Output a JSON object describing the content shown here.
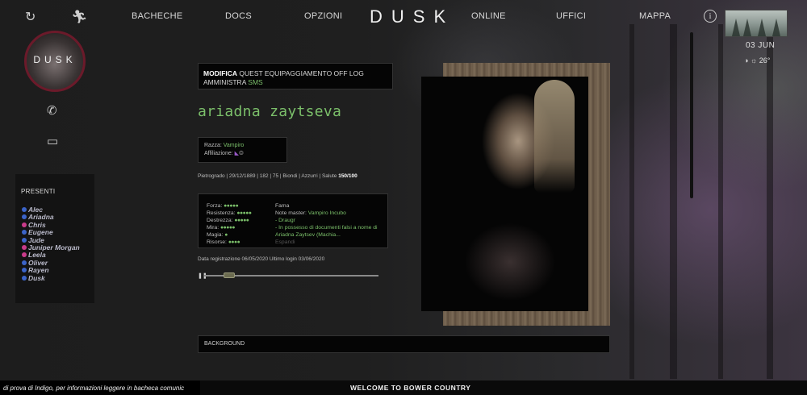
{
  "nav": {
    "refresh_icon": "refresh-icon",
    "runner_icon": "running-person-icon",
    "items": [
      "BACHECHE",
      "DOCS",
      "OPZIONI",
      "ONLINE",
      "UFFICI",
      "MAPPA"
    ],
    "brand": "DUSK",
    "info_icon": "info-icon"
  },
  "weather": {
    "date": "03 JUN",
    "temp": "26°"
  },
  "sidebar": {
    "logo_text": "DUSK",
    "icons": [
      "no-call-icon",
      "chat-icon"
    ],
    "presenti_title": "PRESENTI",
    "users": [
      {
        "name": "Alec",
        "color": "#3b64c9"
      },
      {
        "name": "Ariadna",
        "color": "#3b64c9"
      },
      {
        "name": "Chris",
        "color": "#c93b8a"
      },
      {
        "name": "Eugene",
        "color": "#3b64c9"
      },
      {
        "name": "Jude",
        "color": "#3b64c9"
      },
      {
        "name": "Juniper Morgan",
        "color": "#c93b8a"
      },
      {
        "name": "Leela",
        "color": "#c93b8a"
      },
      {
        "name": "Oliver",
        "color": "#3b64c9"
      },
      {
        "name": "Rayen",
        "color": "#3b64c9"
      },
      {
        "name": "Dusk",
        "color": "#3b64c9"
      }
    ]
  },
  "profile": {
    "menu": {
      "modifica": "MODIFICA",
      "items": "QUEST EQUIPAGGIAMENTO OFF LOG",
      "amministra": "AMMINISTRA",
      "sms": "SMS"
    },
    "name": "ariadna zaytseva",
    "razza_label": "Razza:",
    "razza_value": "Vampiro",
    "affiliazione_label": "Affiliazione:",
    "bio": "Pietrogrado | 29/12/1889 | 182 | 75 | Biondi | Azzurri | Salute",
    "salute": "150/100",
    "stats": [
      {
        "label": "Forza:",
        "pts": "●●●●●"
      },
      {
        "label": "Resistenza:",
        "pts": "●●●●●"
      },
      {
        "label": "Destrezza:",
        "pts": "●●●●●"
      },
      {
        "label": "Mira:",
        "pts": "●●●●●"
      },
      {
        "label": "Magia:",
        "pts": "●"
      },
      {
        "label": "Risorse:",
        "pts": "●●●●"
      }
    ],
    "fama_label": "Fama",
    "note_label": "Note master:",
    "note_value": "Vampiro Incubo",
    "note_lines": [
      "- Draugr",
      "- In possesso di documenti falsi a nome di Ariadna Zaytsev (Machia..."
    ],
    "espandi": "Espandi",
    "registrazione": "Data registrazione 06/05/2020 Ultimo login 03/06/2020",
    "background": "BACKGROUND"
  },
  "footer": {
    "ticker": "di prova di Indigo, per informazioni leggere in bacheca comunic",
    "welcome": "WELCOME TO BOWER COUNTRY"
  },
  "colors": {
    "accent_green": "#7bbf6a",
    "logo_ring": "#6b1a2a"
  }
}
